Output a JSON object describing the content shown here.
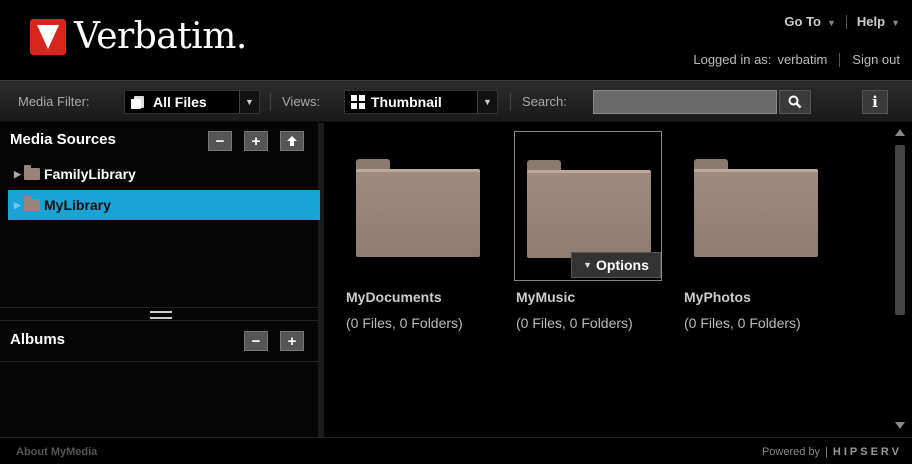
{
  "header": {
    "logo_text": "Verbatim.",
    "goto_label": "Go To",
    "help_label": "Help",
    "logged_in_label": "Logged in as:",
    "username": "verbatim",
    "signout_label": "Sign out"
  },
  "toolbar": {
    "media_filter_label": "Media Filter:",
    "media_filter_value": "All Files",
    "views_label": "Views:",
    "views_value": "Thumbnail",
    "search_label": "Search:",
    "search_value": ""
  },
  "sidebar": {
    "media_sources_title": "Media Sources",
    "sources": [
      {
        "label": "FamilyLibrary"
      },
      {
        "label": "MyLibrary"
      }
    ],
    "albums_title": "Albums"
  },
  "content": {
    "items": [
      {
        "name": "MyDocuments",
        "meta": "(0 Files, 0 Folders)"
      },
      {
        "name": "MyMusic",
        "meta": "(0 Files, 0 Folders)",
        "options_label": "Options"
      },
      {
        "name": "MyPhotos",
        "meta": "(0 Files, 0 Folders)"
      }
    ]
  },
  "footer": {
    "about_label": "About MyMedia",
    "powered_label": "Powered by",
    "brand_label": "HIPSERV"
  },
  "colors": {
    "accent_selected": "#1aa3d6",
    "brand_red": "#d9241b",
    "folder": "#9e8a7e"
  }
}
